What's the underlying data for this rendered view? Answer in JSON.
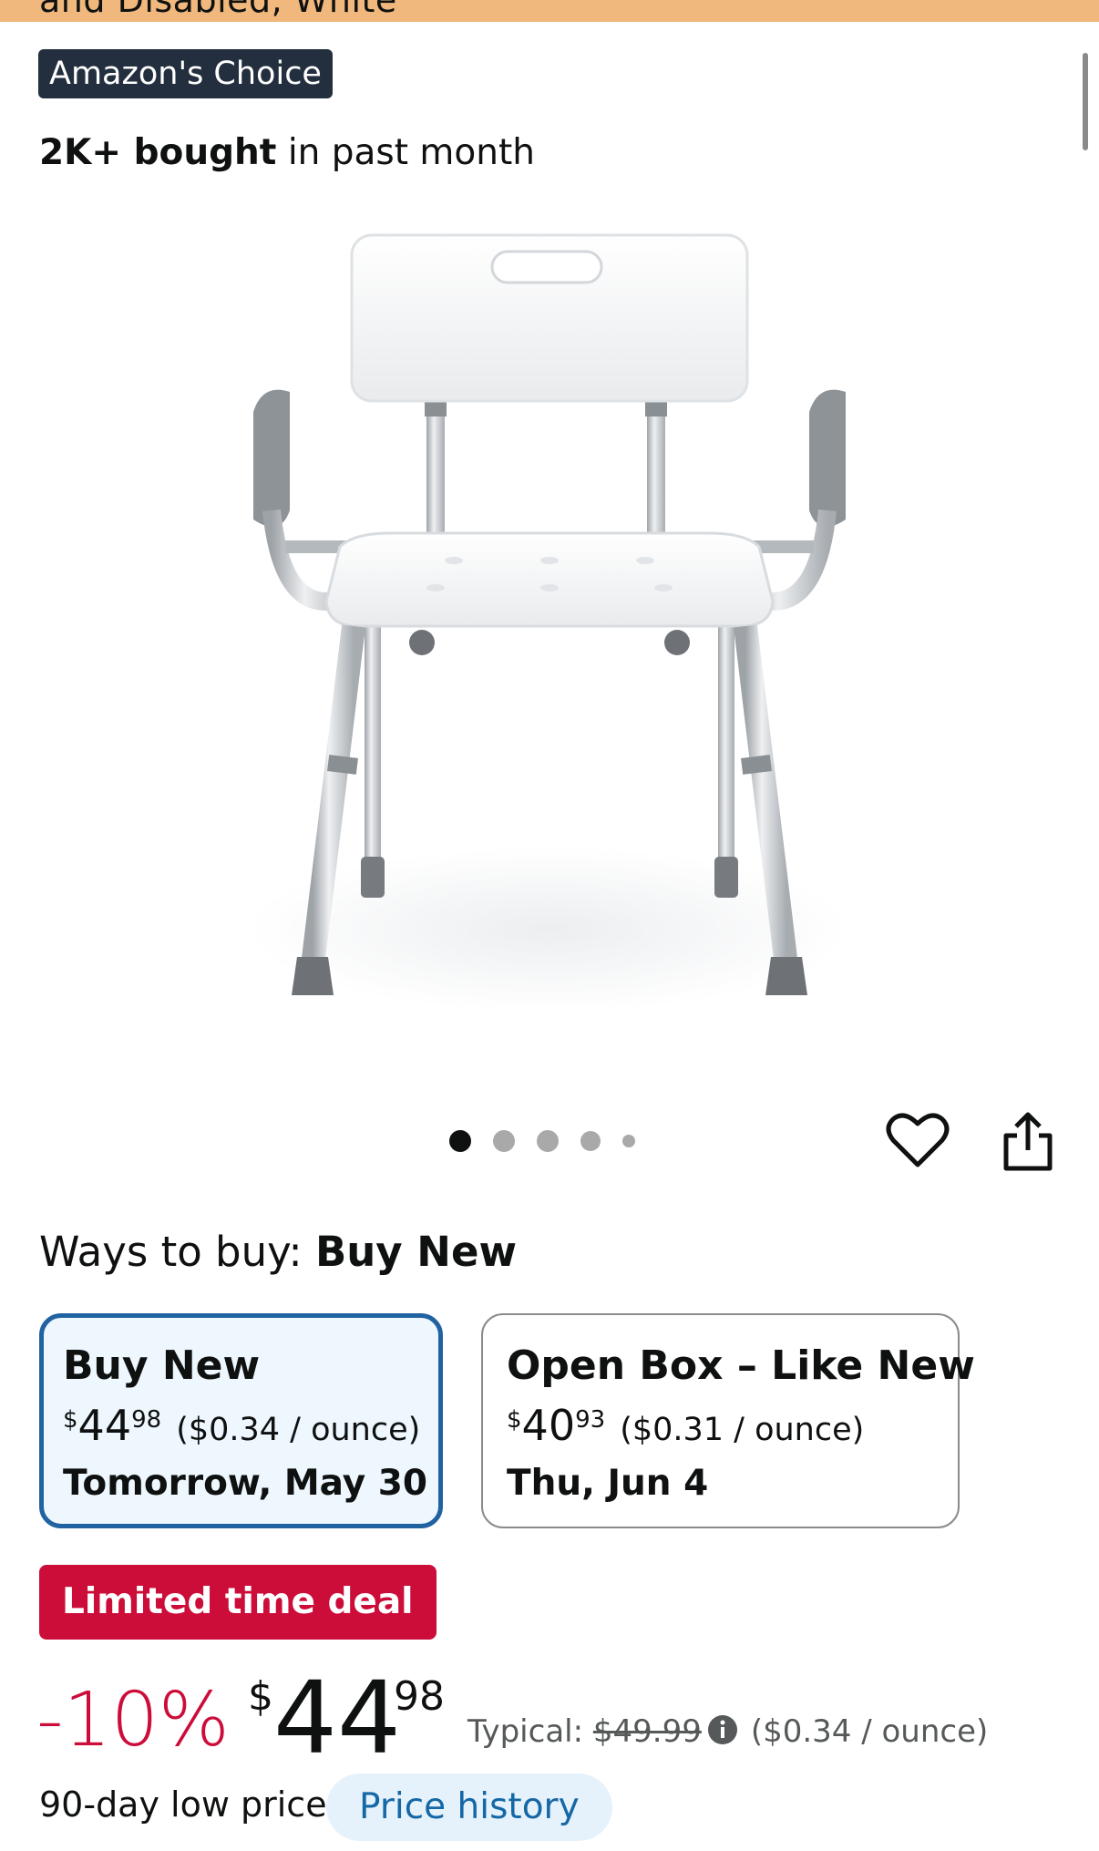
{
  "header": {
    "title_fragment": "and Disabled, White",
    "badge": "Amazon's Choice",
    "bought_bold": "2K+ bought",
    "bought_rest": " in past month"
  },
  "gallery": {
    "image_icon": "shower-chair-image",
    "dot_count": 5,
    "active_dot": 1
  },
  "actions": {
    "wishlist_icon": "heart-icon",
    "share_icon": "share-icon"
  },
  "ways_to_buy": {
    "label": "Ways to buy: ",
    "selected": "Buy New",
    "options": [
      {
        "title": "Buy New",
        "currency": "$",
        "price_whole": "44",
        "price_cents": "98",
        "unit_price": "($0.34 / ounce)",
        "delivery": "Tomorrow, May 30",
        "selected": true
      },
      {
        "title": "Open Box – Like New",
        "currency": "$",
        "price_whole": "40",
        "price_cents": "93",
        "unit_price": "($0.31 / ounce)",
        "delivery": "Thu, Jun 4",
        "selected": false
      }
    ]
  },
  "deal": {
    "badge": "Limited time deal",
    "discount": "-10%",
    "currency": "$",
    "price_whole": "44",
    "price_cents": "98",
    "typical_label": "Typical: ",
    "typical_price": "$49.99",
    "unit_price": "($0.34 / ounce)",
    "low_price_text": "90-day low price",
    "history_button": "Price history"
  },
  "colors": {
    "top_bar": "#f0b87c",
    "badge_bg": "#232f3e",
    "deal_red": "#cc0c39",
    "selected_border": "#2162a1",
    "selected_bg": "#edf7fd",
    "link_blue": "#1568a6"
  }
}
